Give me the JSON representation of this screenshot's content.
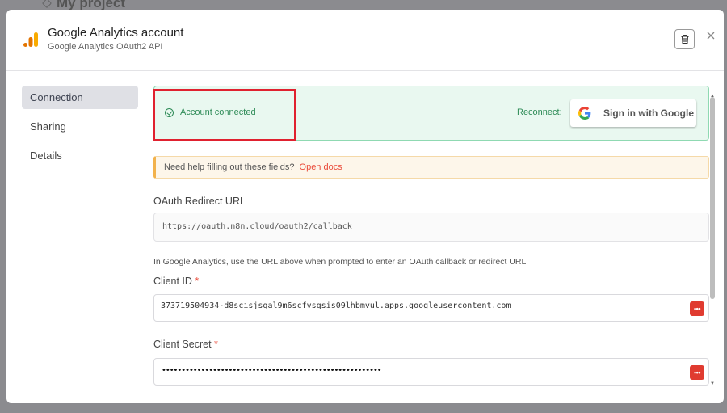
{
  "background": {
    "project_title": "My project"
  },
  "header": {
    "title": "Google Analytics account",
    "subtitle": "Google Analytics OAuth2 API",
    "logo_icon": "google-analytics-logo",
    "delete_icon": "trash-icon",
    "close_icon": "close-icon"
  },
  "sidebar": {
    "items": [
      {
        "label": "Connection",
        "active": true
      },
      {
        "label": "Sharing",
        "active": false
      },
      {
        "label": "Details",
        "active": false
      }
    ]
  },
  "status": {
    "text": "Account connected",
    "reconnect_label": "Reconnect:",
    "google_button_label": "Sign in with Google"
  },
  "help": {
    "text": "Need help filling out these fields?",
    "link": "Open docs"
  },
  "fields": {
    "redirect_label": "OAuth Redirect URL",
    "redirect_value": "https://oauth.n8n.cloud/oauth2/callback",
    "redirect_hint": "In Google Analytics, use the URL above when prompted to enter an OAuth callback or redirect URL",
    "client_id_label": "Client ID",
    "client_id_value": "373719504934-d8scisjsqal9m6scfvsqsis09lhbmvul.apps.googleusercontent.com",
    "client_secret_label": "Client Secret",
    "client_secret_value": "••••••••••••••••••••••••••••••••••••••••••••••••••••••••",
    "required_mark": "*",
    "password_button_icon": "more-dots-icon"
  },
  "colors": {
    "accent_red": "#ea4b3a",
    "success_green": "#2e8b57",
    "highlight_box": "#e0212f"
  }
}
